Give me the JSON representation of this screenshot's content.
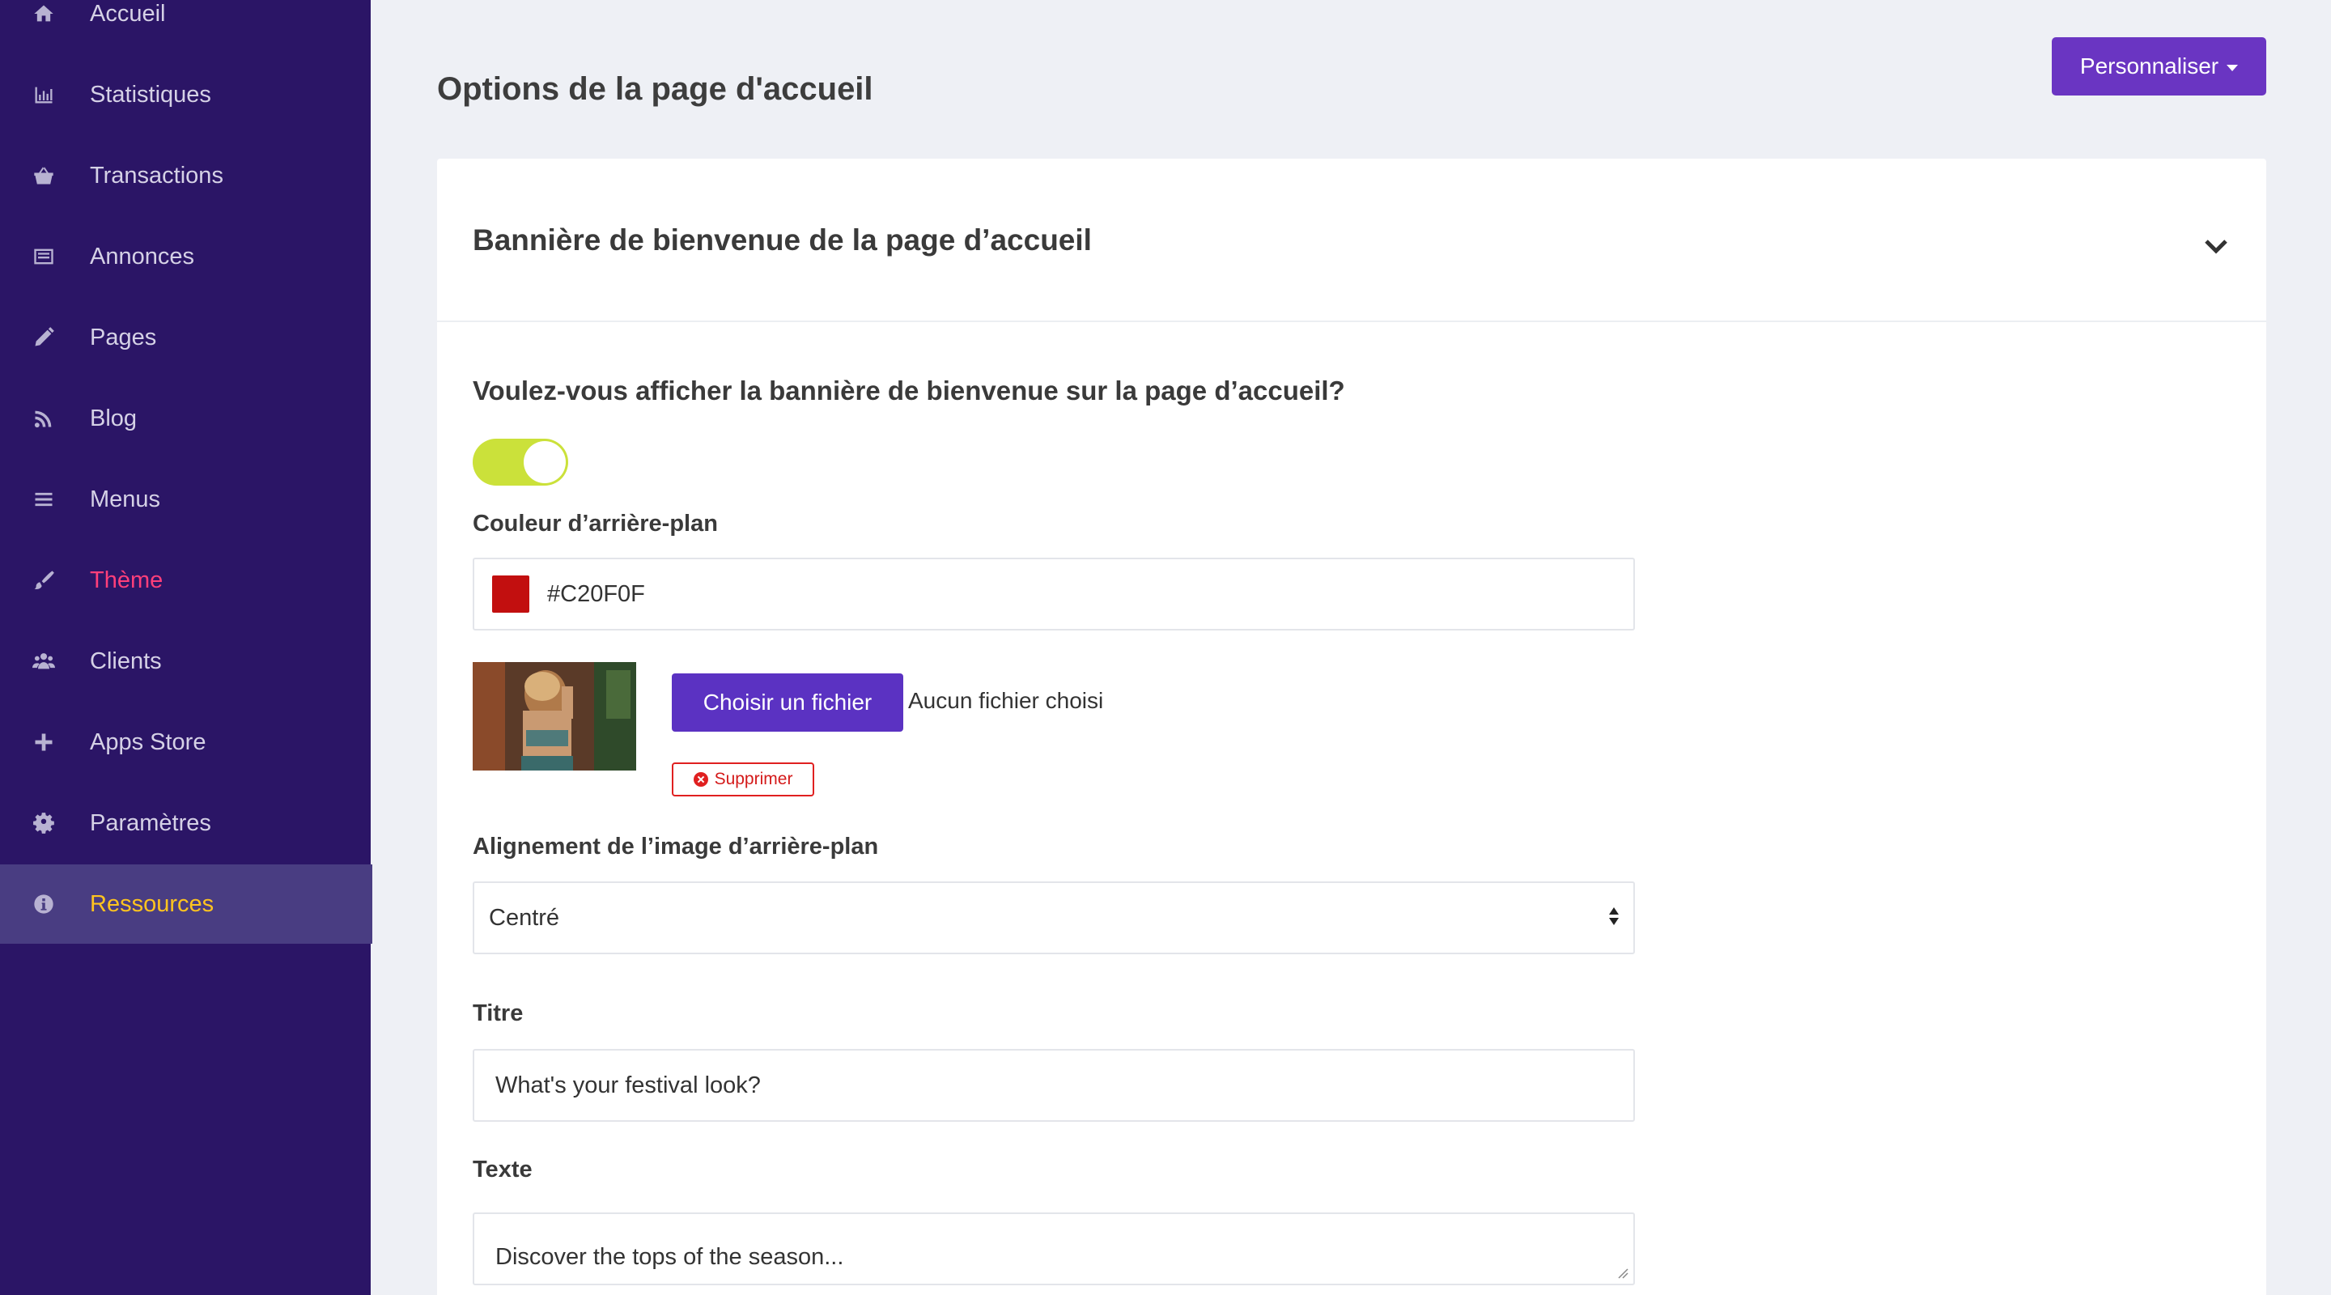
{
  "sidebar": {
    "items": [
      {
        "label": "Accueil",
        "icon": "home-icon"
      },
      {
        "label": "Statistiques",
        "icon": "bar-chart-icon"
      },
      {
        "label": "Transactions",
        "icon": "basket-icon"
      },
      {
        "label": "Annonces",
        "icon": "list-card-icon"
      },
      {
        "label": "Pages",
        "icon": "pencil-icon"
      },
      {
        "label": "Blog",
        "icon": "rss-icon"
      },
      {
        "label": "Menus",
        "icon": "hamburger-icon"
      },
      {
        "label": "Thème",
        "icon": "brush-icon",
        "color": "#ff3f7a"
      },
      {
        "label": "Clients",
        "icon": "users-icon"
      },
      {
        "label": "Apps Store",
        "icon": "plus-icon"
      },
      {
        "label": "Paramètres",
        "icon": "gear-icon"
      },
      {
        "label": "Ressources",
        "icon": "info-icon",
        "color": "#ffc41f",
        "highlighted": true
      }
    ],
    "background": "#2b1566"
  },
  "header": {
    "title": "Options de la page d'accueil",
    "customize_label": "Personnaliser"
  },
  "banner_section": {
    "title": "Bannière de bienvenue de la page d’accueil",
    "question": "Voulez-vous afficher la bannière de bienvenue sur la page d’accueil?",
    "toggle_on": true,
    "toggle_color": "#cbe13a",
    "bg_color_label": "Couleur d’arrière-plan",
    "bg_color_value": "#C20F0F",
    "file_button_label": "Choisir un fichier",
    "file_status": "Aucun fichier choisi",
    "delete_label": "Supprimer",
    "alignment_label": "Alignement de l’image d’arrière-plan",
    "alignment_value": "Centré",
    "title_label": "Titre",
    "title_value": "What's your festival look?",
    "text_label": "Texte",
    "text_value": "Discover the tops of the season..."
  },
  "colors": {
    "accent": "#6a35c2",
    "danger": "#e02020"
  }
}
